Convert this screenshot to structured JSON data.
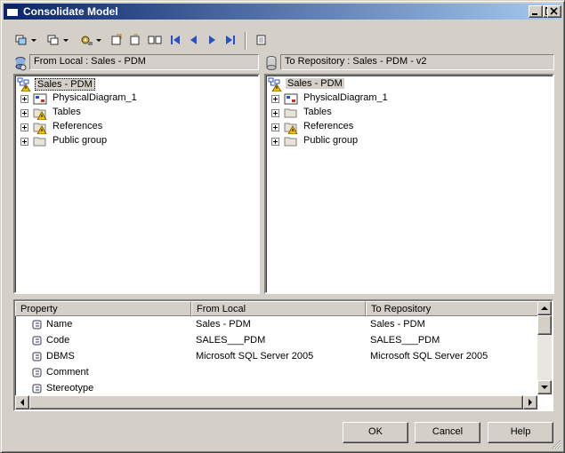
{
  "window": {
    "title": "Consolidate Model"
  },
  "left_panel": {
    "header": "From Local : Sales - PDM",
    "root": "Sales - PDM",
    "items": [
      {
        "label": "PhysicalDiagram_1",
        "icon": "diagram-icon"
      },
      {
        "label": "Tables",
        "icon": "folder-warning-icon"
      },
      {
        "label": "References",
        "icon": "folder-warning-icon"
      },
      {
        "label": "Public group",
        "icon": "folder-icon"
      }
    ]
  },
  "right_panel": {
    "header": "To Repository : Sales - PDM - v2",
    "root": "Sales - PDM",
    "items": [
      {
        "label": "PhysicalDiagram_1",
        "icon": "diagram-icon"
      },
      {
        "label": "Tables",
        "icon": "folder-icon"
      },
      {
        "label": "References",
        "icon": "folder-warning-icon"
      },
      {
        "label": "Public group",
        "icon": "folder-icon"
      }
    ]
  },
  "grid": {
    "columns": [
      "Property",
      "From Local",
      "To Repository"
    ],
    "rows": [
      {
        "property": "Name",
        "from_local": "Sales - PDM",
        "to_repository": "Sales - PDM"
      },
      {
        "property": "Code",
        "from_local": "SALES___PDM",
        "to_repository": "SALES___PDM"
      },
      {
        "property": "DBMS",
        "from_local": "Microsoft SQL Server 2005",
        "to_repository": "Microsoft SQL Server 2005"
      },
      {
        "property": "Comment",
        "from_local": "",
        "to_repository": ""
      },
      {
        "property": "Stereotype",
        "from_local": "",
        "to_repository": ""
      }
    ]
  },
  "buttons": {
    "ok": "OK",
    "cancel": "Cancel",
    "help": "Help"
  },
  "colors": {
    "title_start": "#0a246a",
    "title_end": "#a6caf0",
    "face": "#d4d0c8",
    "nav_blue": "#2a50c8",
    "warning": "#f0c000"
  }
}
